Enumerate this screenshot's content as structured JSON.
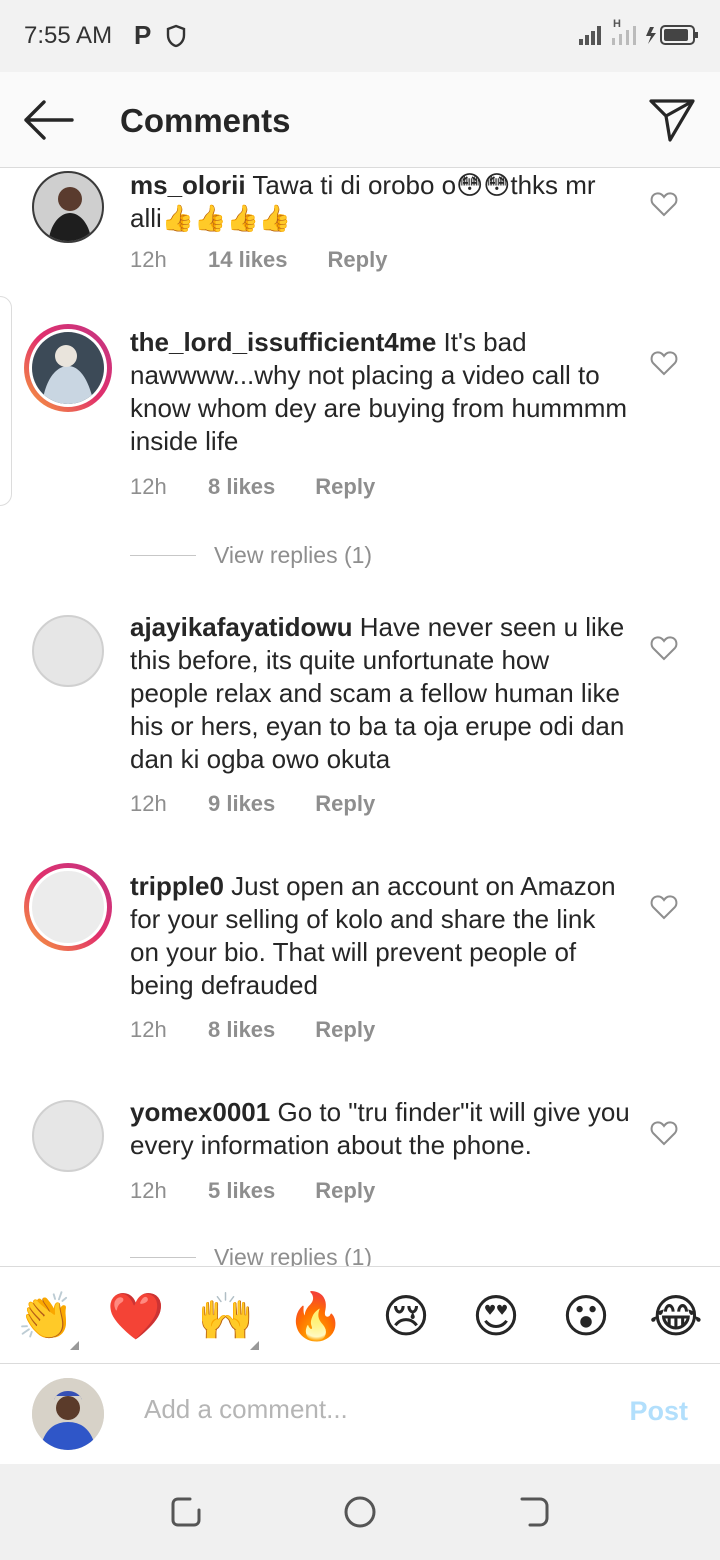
{
  "status_bar": {
    "time": "7:55 AM",
    "p_label": "P",
    "network_label": "H",
    "icons": [
      "p-notification-icon",
      "shield-icon",
      "signal-icon",
      "signal-h-icon",
      "battery-charging-icon"
    ]
  },
  "header": {
    "title": "Comments",
    "icons": [
      "back-arrow-icon",
      "send-icon"
    ]
  },
  "comments": [
    {
      "username": "ms_olorii",
      "text": "Tawa ti di orobo o😳😳thks mr alli👍👍👍👍",
      "time": "12h",
      "likes": "14 likes",
      "reply": "Reply"
    },
    {
      "username": "the_lord_issufficient4me",
      "text": "It's bad nawwww...why not placing a video call to know whom dey are buying from hummmm inside life",
      "time": "12h",
      "likes": "8 likes",
      "reply": "Reply",
      "view_replies": "View replies (1)"
    },
    {
      "username": "ajayikafayatidowu",
      "text": "Have never seen u like this before, its quite unfortunate how people relax and scam a fellow human like his or hers, eyan to ba ta oja erupe odi dan dan ki ogba owo okuta",
      "time": "12h",
      "likes": "9 likes",
      "reply": "Reply"
    },
    {
      "username": "tripple0",
      "text": "Just open an account on Amazon for your  selling of kolo and share the link on your bio. That will prevent people of being defrauded",
      "time": "12h",
      "likes": "8 likes",
      "reply": "Reply"
    },
    {
      "username": "yomex0001",
      "text": "Go to \"tru finder\"it will give you every information about the phone.",
      "time": "12h",
      "likes": "5 likes",
      "reply": "Reply",
      "view_replies": "View replies (1)"
    }
  ],
  "emoji_bar": [
    "👏",
    "❤️",
    "🙌",
    "🔥",
    "😢",
    "😍",
    "😮",
    "😂"
  ],
  "composer": {
    "placeholder": "Add a comment...",
    "post_label": "Post"
  },
  "colors": {
    "ring_start": "#f7a23a",
    "ring_end": "#c13584",
    "post_disabled": "#b2dffc",
    "meta_grey": "#8e8e8e"
  }
}
